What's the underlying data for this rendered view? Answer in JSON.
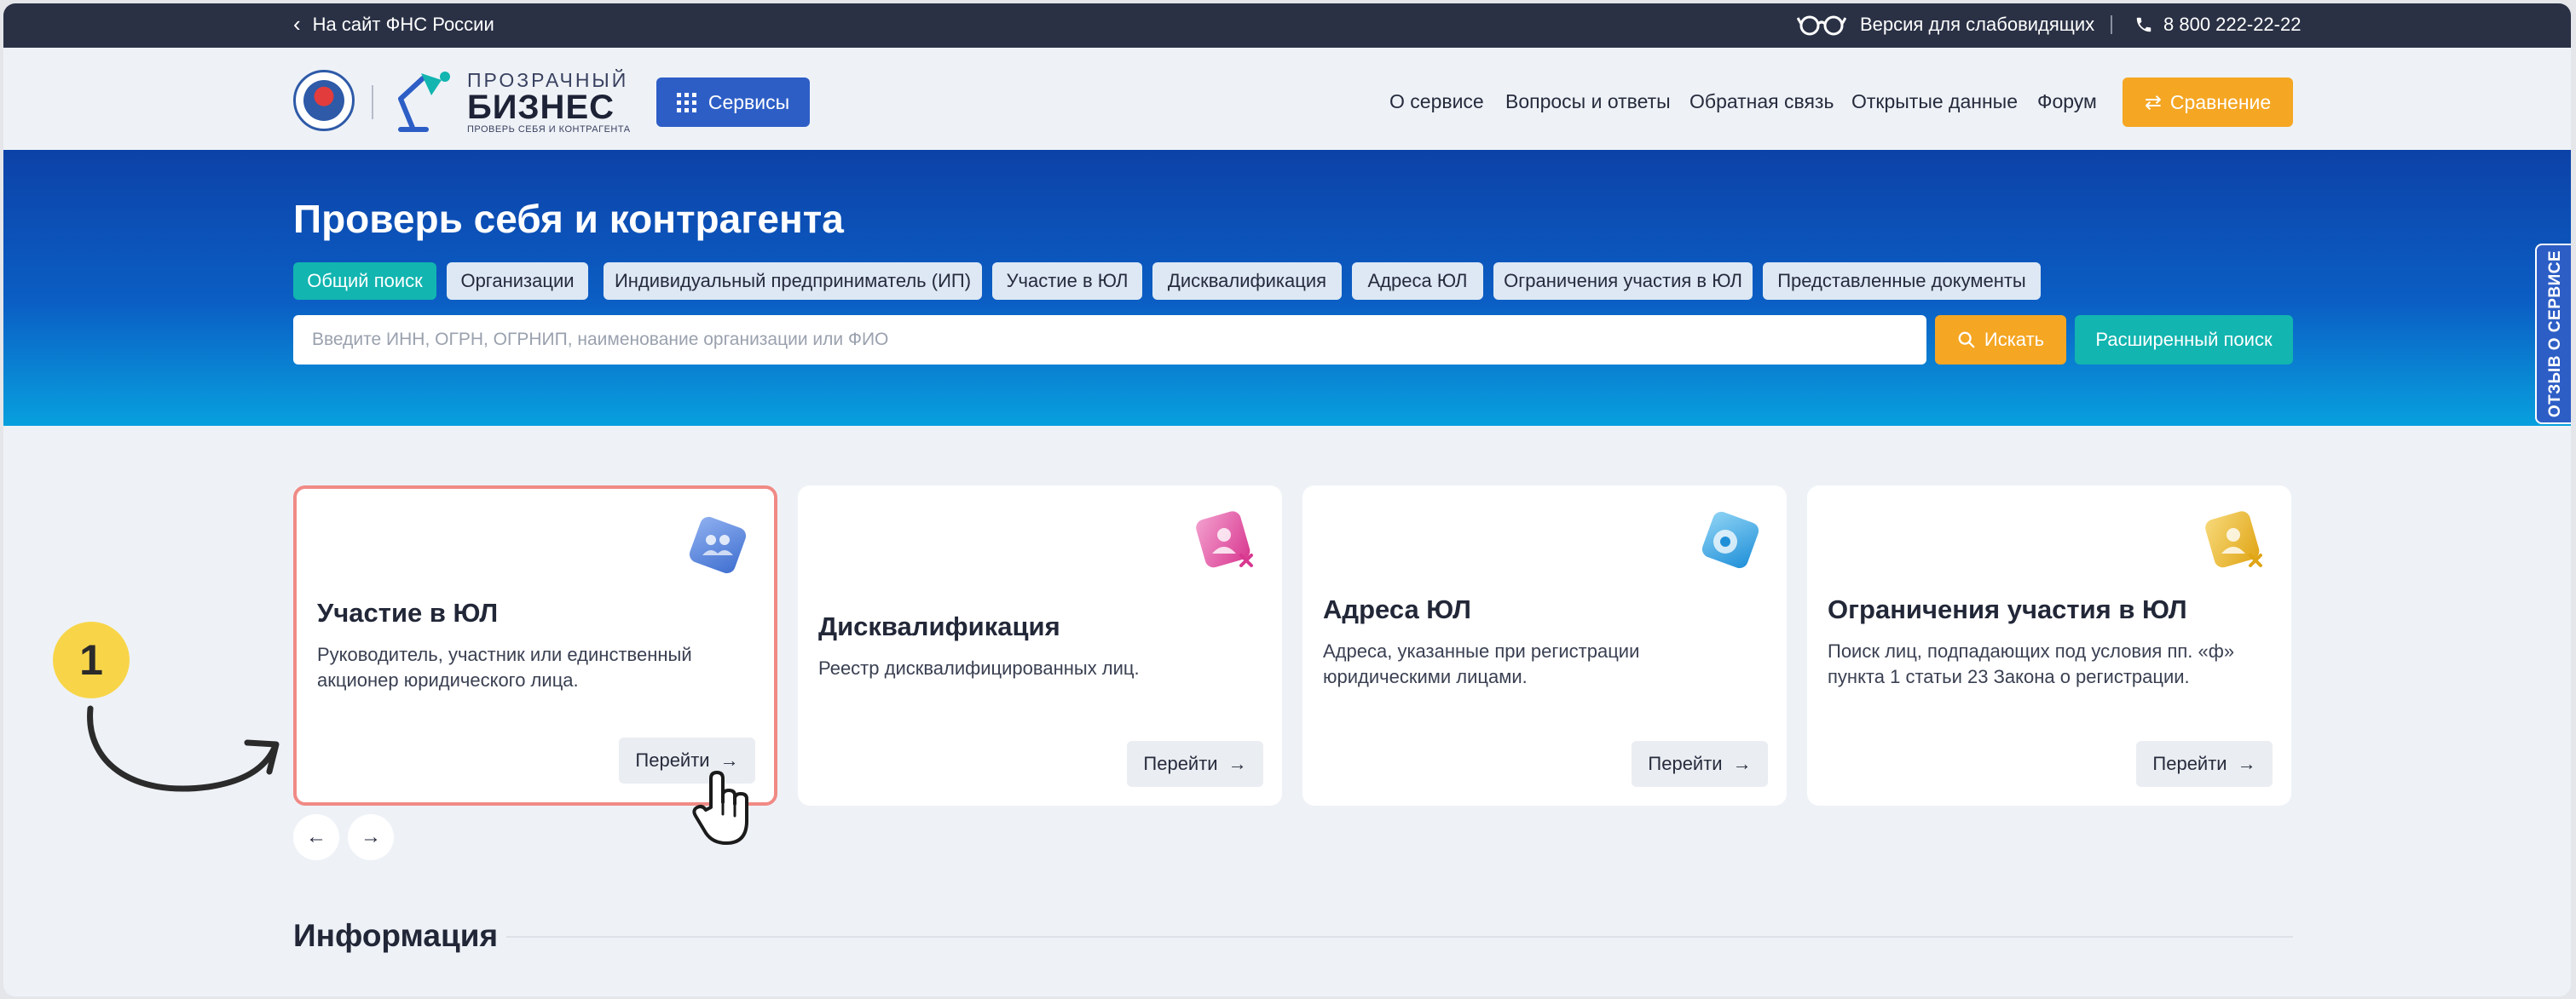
{
  "topbar": {
    "back_label": "На сайт ФНС России",
    "accessibility_label": "Версия для слабовидящих",
    "phone": "8 800 222-22-22"
  },
  "header": {
    "logo_line1": "ПРОЗРАЧНЫЙ",
    "logo_line2": "БИЗНЕС",
    "logo_line3": "ПРОВЕРЬ СЕБЯ И КОНТРАГЕНТА",
    "services_label": "Сервисы",
    "nav": [
      "О сервисе",
      "Вопросы и ответы",
      "Обратная связь",
      "Открытые данные",
      "Форум"
    ],
    "compare_label": "Сравнение"
  },
  "hero": {
    "title": "Проверь себя и контрагента",
    "tabs": [
      "Общий поиск",
      "Организации",
      "Индивидуальный предприниматель (ИП)",
      "Участие в ЮЛ",
      "Дисквалификация",
      "Адреса ЮЛ",
      "Ограничения участия в ЮЛ",
      "Представленные документы"
    ],
    "active_tab": "Общий поиск",
    "search_placeholder": "Введите ИНН, ОГРН, ОГРНИП, наименование организации или ФИО",
    "search_value": "",
    "search_label": "Искать",
    "advanced_label": "Расширенный поиск"
  },
  "feedback_tab": "ОТЗЫВ О СЕРВИСЕ",
  "cards": [
    {
      "title": "Участие в ЮЛ",
      "description": "Руководитель, участник или единственный акционер юридического лица.",
      "button": "Перейти",
      "icon": "people-icon",
      "color": "#4f7fd6"
    },
    {
      "title": "Дисквалификация",
      "description": "Реестр дисквалифицированных лиц.",
      "button": "Перейти",
      "icon": "person-x-icon",
      "color": "#e04aa0"
    },
    {
      "title": "Адреса ЮЛ",
      "description": "Адреса, указанные при регистрации юридическими лицами.",
      "button": "Перейти",
      "icon": "location-icon",
      "color": "#2ea3e0"
    },
    {
      "title": "Ограничения участия в ЮЛ",
      "description": "Поиск лиц, подпадающих под условия пп. «ф» пункта 1 статьи 23 Закона о регистрации.",
      "button": "Перейти",
      "icon": "person-x-icon",
      "color": "#e8b32a"
    }
  ],
  "info": {
    "title": "Информация"
  },
  "annotation": {
    "step": "1"
  },
  "colors": {
    "accent_blue": "#2d5ec6",
    "accent_orange": "#f5a623",
    "accent_teal": "#12b5b0",
    "topbar": "#2a3145"
  }
}
